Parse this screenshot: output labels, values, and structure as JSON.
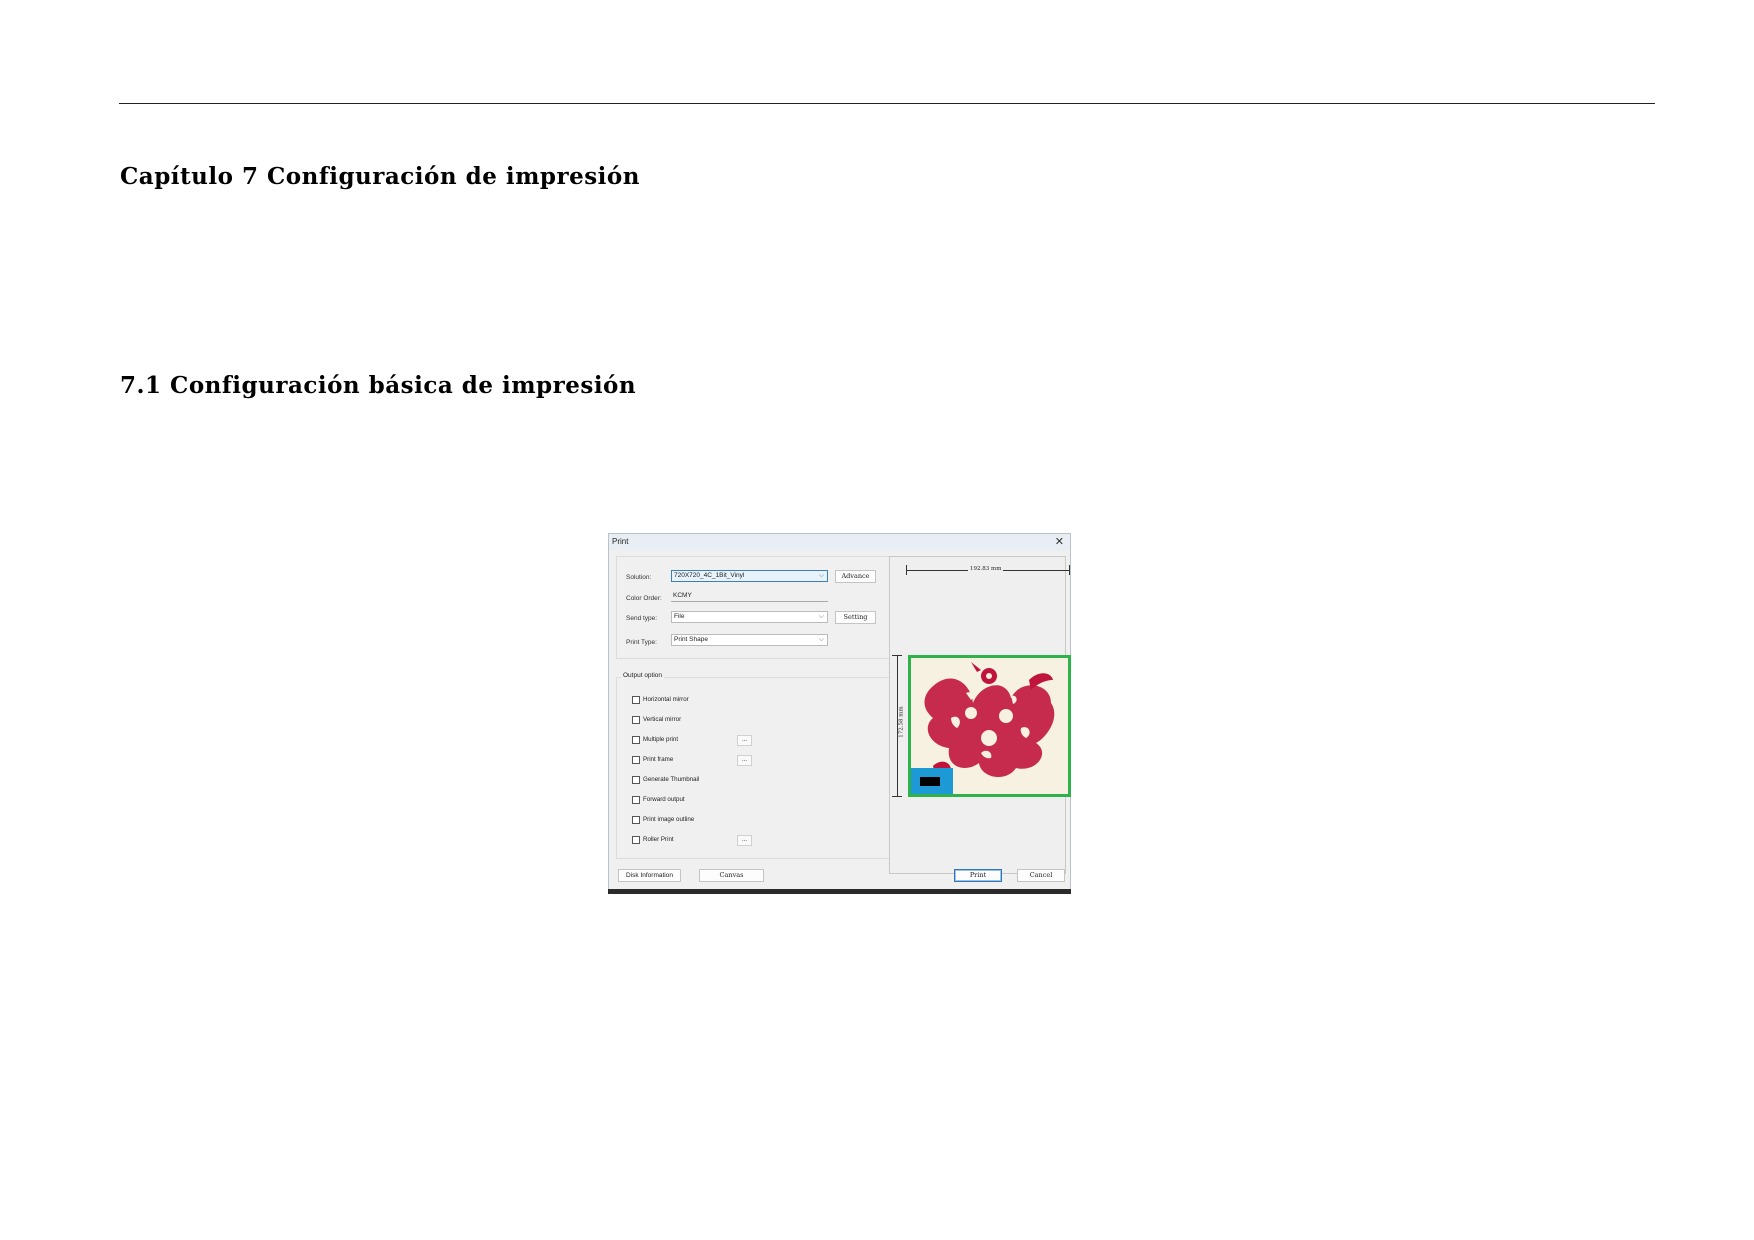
{
  "page": {
    "chapter_title": "Capítulo 7 Configuración de impresión",
    "section_title": "7.1 Configuración básica de impresión"
  },
  "dialog": {
    "title": "Print",
    "close_glyph": "✕",
    "solution": {
      "label": "Solution:",
      "value": "720X720_4C_1Bit_Vinyl",
      "advance_label": "Advance"
    },
    "color_order": {
      "label": "Color Order:",
      "value": "KCMY"
    },
    "send_type": {
      "label": "Send type:",
      "value": "File",
      "setting_label": "Setting"
    },
    "print_type": {
      "label": "Print Type:",
      "value": "Print Shape"
    },
    "output_option": {
      "legend": "Output option",
      "items": [
        {
          "label": "Horizontal mirror",
          "checked": false,
          "has_more": false
        },
        {
          "label": "Vertical mirror",
          "checked": false,
          "has_more": false
        },
        {
          "label": "Multiple print",
          "checked": false,
          "has_more": true
        },
        {
          "label": "Print frame",
          "checked": false,
          "has_more": true
        },
        {
          "label": "Generate Thumbnail",
          "checked": false,
          "has_more": false
        },
        {
          "label": "Forward output",
          "checked": false,
          "has_more": false
        },
        {
          "label": "Print image outline",
          "checked": false,
          "has_more": false
        },
        {
          "label": "Roller Print",
          "checked": false,
          "has_more": true
        }
      ],
      "more_glyph": "..."
    },
    "preview": {
      "width_label": "192.83 mm",
      "height_label": "172.58 mm"
    },
    "buttons": {
      "disk_information": "Disk Information",
      "canvas": "Canvas",
      "print": "Print",
      "cancel": "Cancel"
    },
    "chevron_glyph": "⌵"
  },
  "colors": {
    "frame_green": "#2eb34a",
    "artwork_red": "#c0143c",
    "origin_blue": "#1d9ad6"
  }
}
